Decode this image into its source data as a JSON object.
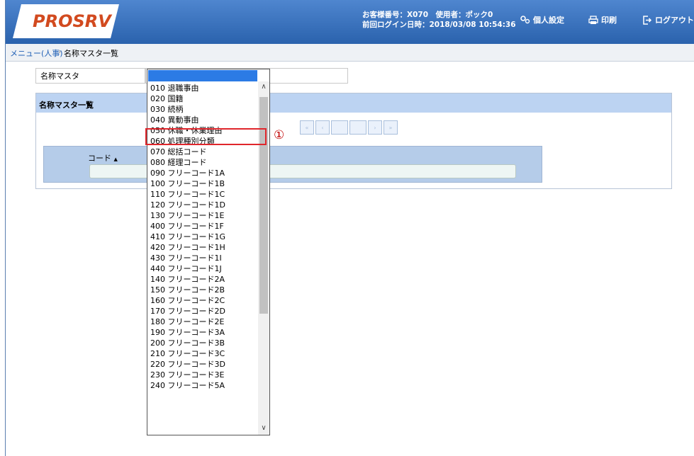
{
  "header": {
    "logo_text": "PROSRV",
    "customer_line": "お客様番号：X070　使用者：ポック0",
    "last_login_line": "前回ログイン日時：2018/03/08 10:54:36",
    "personal_settings": "個人設定",
    "print": "印刷",
    "logout": "ログアウト"
  },
  "breadcrumb": {
    "menu_link": "メニュー(人事)",
    "separator": "›",
    "current": "名称マスタ一覧"
  },
  "filter": {
    "label": "名称マスタ",
    "value": ""
  },
  "panel": {
    "title": "名称マスタ一覧",
    "pager": [
      "«",
      "‹",
      "",
      "",
      "›",
      "»"
    ],
    "column_code": "コード",
    "sort_arrow": "▲"
  },
  "dropdown": {
    "selected_value": "",
    "options": [
      "010 退職事由",
      "020 国籍",
      "030 続柄",
      "040 異動事由",
      "050 休職・休業理由",
      "060 処理種別分類",
      "070 総括コード",
      "080 経理コード",
      "090 フリーコード1A",
      "100 フリーコード1B",
      "110 フリーコード1C",
      "120 フリーコード1D",
      "130 フリーコード1E",
      "400 フリーコード1F",
      "410 フリーコード1G",
      "420 フリーコード1H",
      "430 フリーコード1I",
      "440 フリーコード1J",
      "140 フリーコード2A",
      "150 フリーコード2B",
      "160 フリーコード2C",
      "170 フリーコード2D",
      "180 フリーコード2E",
      "190 フリーコード3A",
      "200 フリーコード3B",
      "210 フリーコード3C",
      "220 フリーコード3D",
      "230 フリーコード3E",
      "240 フリーコード5A"
    ],
    "highlighted_option": "050 休職・休業理由"
  },
  "annotation": {
    "marker": "①"
  },
  "colors": {
    "header": "#3a72c0",
    "highlight_box": "#e0262c",
    "selected_row": "#2c7be5",
    "panel_head": "#bcd3f2"
  }
}
